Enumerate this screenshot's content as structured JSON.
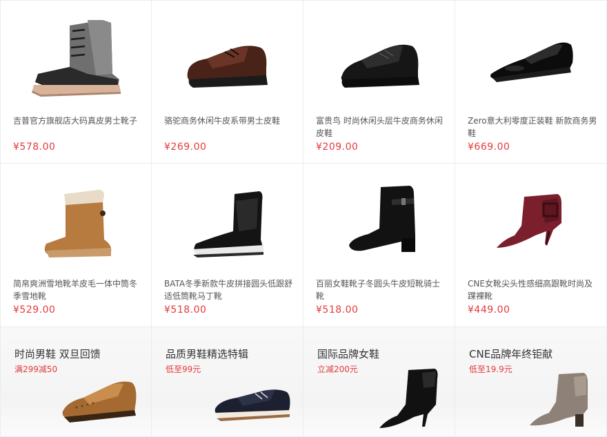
{
  "products": [
    {
      "title": "吉普官方旗舰店大码真皮男士靴子",
      "price": "¥578.00",
      "icon": "wingtip-boot-icon"
    },
    {
      "title": "骆驼商务休闲牛皮系带男士皮鞋",
      "price": "¥269.00",
      "icon": "brown-derby-shoe-icon"
    },
    {
      "title": "富贵鸟 时尚休闲头层牛皮商务休闲皮鞋",
      "price": "¥209.00",
      "icon": "black-casual-shoe-icon"
    },
    {
      "title": "Zero意大利零度正装鞋 新款商务男鞋",
      "price": "¥669.00",
      "icon": "oxford-dress-shoe-icon"
    },
    {
      "title": "简帛爽洲雪地靴羊皮毛一体中筒冬季雪地靴",
      "price": "¥529.00",
      "icon": "snow-boot-icon"
    },
    {
      "title": "BATA冬季新款牛皮拼接圆头低跟舒适低筒靴马丁靴",
      "price": "¥518.00",
      "icon": "ankle-boot-icon"
    },
    {
      "title": "百丽女鞋靴子冬圆头牛皮短靴骑士靴",
      "price": "¥518.00",
      "icon": "block-heel-boot-icon"
    },
    {
      "title": "CNE女靴尖头性感细高跟靴时尚及踝裸靴",
      "price": "¥449.00",
      "icon": "stiletto-bootie-icon"
    }
  ],
  "promos": [
    {
      "title": "时尚男鞋 双旦回馈",
      "subtitle": "满299减50",
      "icon": "brogue-shoe-icon"
    },
    {
      "title": "品质男鞋精选特辑",
      "subtitle": "低至99元",
      "icon": "boat-shoe-icon"
    },
    {
      "title": "国际品牌女鞋",
      "subtitle": "立减200元",
      "icon": "heeled-bootie-icon"
    },
    {
      "title": "CNE品牌年终钜献",
      "subtitle": "低至19.9元",
      "icon": "taupe-bootie-icon"
    }
  ],
  "colors": {
    "price": "#e4393c",
    "border": "#ececec"
  }
}
